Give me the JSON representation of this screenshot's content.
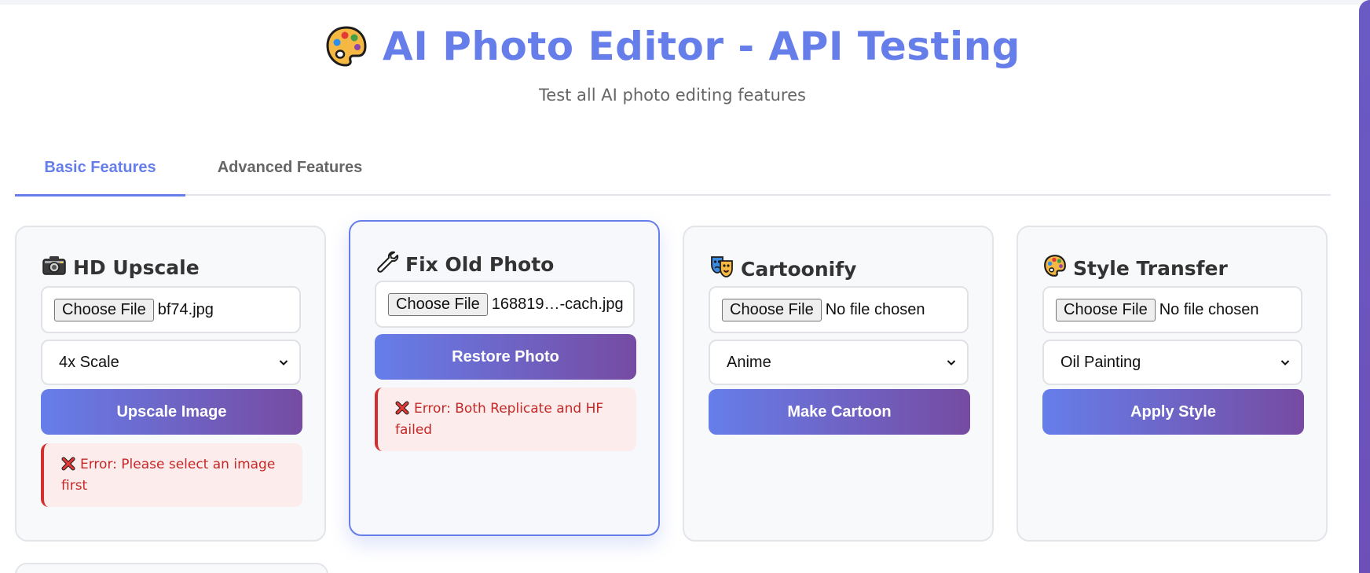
{
  "header": {
    "title": "AI Photo Editor - API Testing",
    "subtitle": "Test all AI photo editing features"
  },
  "tabs": [
    {
      "label": "Basic Features",
      "active": true
    },
    {
      "label": "Advanced Features",
      "active": false
    }
  ],
  "cards": {
    "upscale": {
      "title": "HD Upscale",
      "icon": "camera-icon",
      "file_button": "Choose File",
      "file_name": "bf74.jpg",
      "select_value": "4x Scale",
      "button": "Upscale Image",
      "error": "Error: Please select an image first"
    },
    "restore": {
      "title": "Fix Old Photo",
      "icon": "wrench-icon",
      "file_button": "Choose File",
      "file_name": "168819…-cach.jpg",
      "button": "Restore Photo",
      "error": "Error: Both Replicate and HF failed"
    },
    "cartoon": {
      "title": "Cartoonify",
      "icon": "theater-masks-icon",
      "file_button": "Choose File",
      "file_name": "No file chosen",
      "select_value": "Anime",
      "button": "Make Cartoon"
    },
    "style": {
      "title": "Style Transfer",
      "icon": "palette-icon",
      "file_button": "Choose File",
      "file_name": "No file chosen",
      "select_value": "Oil Painting",
      "button": "Apply Style"
    }
  },
  "colors": {
    "accent": "#667eea",
    "gradient_end": "#764ba2",
    "error_text": "#c62828",
    "error_bg": "#fdecec"
  }
}
